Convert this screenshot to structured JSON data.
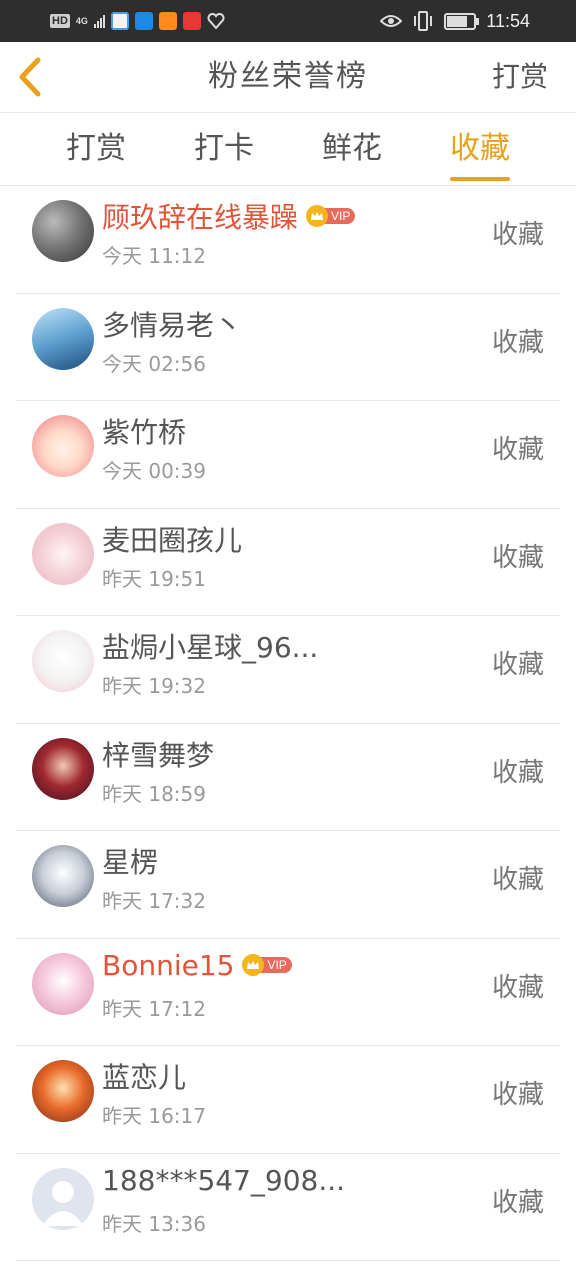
{
  "status_bar": {
    "hd": "HD",
    "network": "4G",
    "time": "11:54"
  },
  "header": {
    "title": "粉丝荣誉榜",
    "action": "打赏"
  },
  "tabs": [
    {
      "label": "打赏",
      "active": false
    },
    {
      "label": "打卡",
      "active": false
    },
    {
      "label": "鲜花",
      "active": false
    },
    {
      "label": "收藏",
      "active": true
    }
  ],
  "colors": {
    "accent": "#e8a21b",
    "vip_name": "#e0553a",
    "status_bar": "#2e2e2e"
  },
  "vip_label": "VIP",
  "fans": [
    {
      "name": "顾玖辞在线暴躁",
      "time": "今天 11:12",
      "action": "收藏",
      "vip": true,
      "avatar": "avatar-gray"
    },
    {
      "name": "多情易老丶",
      "time": "今天 02:56",
      "action": "收藏",
      "vip": false,
      "avatar": "avatar-blue"
    },
    {
      "name": "紫竹桥",
      "time": "今天 00:39",
      "action": "收藏",
      "vip": false,
      "avatar": "avatar-cartoon"
    },
    {
      "name": "麦田圈孩儿",
      "time": "昨天 19:51",
      "action": "收藏",
      "vip": false,
      "avatar": "avatar-pink"
    },
    {
      "name": "盐焗小星球_96...",
      "time": "昨天 19:32",
      "action": "收藏",
      "vip": false,
      "avatar": "avatar-sketch"
    },
    {
      "name": "梓雪舞梦",
      "time": "昨天 18:59",
      "action": "收藏",
      "vip": false,
      "avatar": "avatar-red"
    },
    {
      "name": "星楞",
      "time": "昨天 17:32",
      "action": "收藏",
      "vip": false,
      "avatar": "avatar-white"
    },
    {
      "name": "Bonnie15",
      "time": "昨天 17:12",
      "action": "收藏",
      "vip": true,
      "avatar": "avatar-rose"
    },
    {
      "name": "蓝恋儿",
      "time": "昨天 16:17",
      "action": "收藏",
      "vip": false,
      "avatar": "avatar-autumn"
    },
    {
      "name": "188***547_908...",
      "time": "昨天 13:36",
      "action": "收藏",
      "vip": false,
      "avatar": "avatar-default"
    }
  ]
}
